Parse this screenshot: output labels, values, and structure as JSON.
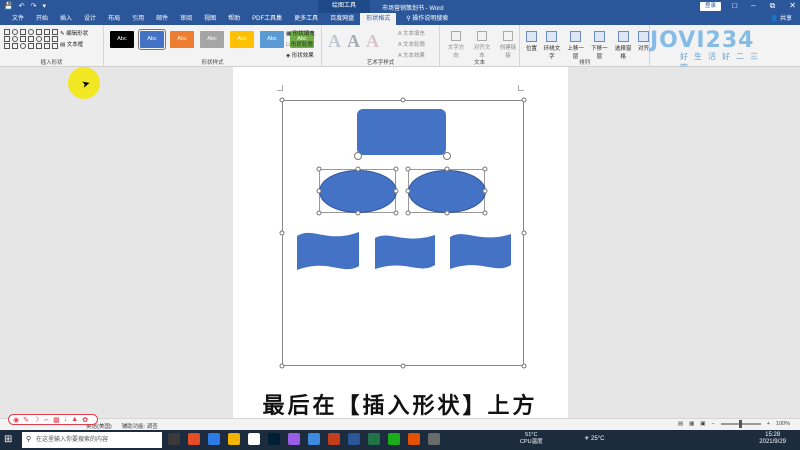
{
  "titlebar": {
    "context_tab": "绘图工具",
    "document_title": "市场营销策划书 - Word",
    "login_label": "登录",
    "window_controls": [
      "minimize-icon",
      "restore-icon",
      "close-icon"
    ]
  },
  "tabs": [
    {
      "label": "文件",
      "active": false
    },
    {
      "label": "开始",
      "active": false
    },
    {
      "label": "插入",
      "active": false
    },
    {
      "label": "设计",
      "active": false
    },
    {
      "label": "布局",
      "active": false
    },
    {
      "label": "引用",
      "active": false
    },
    {
      "label": "邮件",
      "active": false
    },
    {
      "label": "审阅",
      "active": false
    },
    {
      "label": "视图",
      "active": false
    },
    {
      "label": "帮助",
      "active": false
    },
    {
      "label": "PDF工具集",
      "active": false
    },
    {
      "label": "更多工具",
      "active": false
    },
    {
      "label": "百度网盘",
      "active": false
    },
    {
      "label": "形状格式",
      "active": true
    }
  ],
  "tell_me": "操作说明搜索",
  "share_label": "共享",
  "ribbon": {
    "insert_shapes": {
      "edit_shape": "编辑形状",
      "text_box": "文本框",
      "group_label": "插入形状"
    },
    "shape_styles": {
      "swatches": [
        {
          "label": "Abc",
          "color": "#000000"
        },
        {
          "label": "Abc",
          "color": "#4472c4",
          "selected": true
        },
        {
          "label": "Abc",
          "color": "#ed7d31"
        },
        {
          "label": "Abc",
          "color": "#a5a5a5"
        },
        {
          "label": "Abc",
          "color": "#ffc000"
        },
        {
          "label": "Abc",
          "color": "#5b9bd5"
        },
        {
          "label": "Abc",
          "color": "#70ad47"
        }
      ],
      "fill": "形状填充",
      "outline": "形状轮廓",
      "effects": "形状效果",
      "group_label": "形状样式"
    },
    "wordart": {
      "letters": [
        "A",
        "A",
        "A"
      ],
      "text_fill": "文本填充",
      "text_outline": "文本轮廓",
      "text_effects": "文本效果",
      "group_label": "艺术字样式"
    },
    "text": {
      "direction": "文字方向",
      "align": "对齐文本",
      "link": "创建链接",
      "group_label": "文本"
    },
    "arrange": {
      "position": "位置",
      "wrap": "环绕文字",
      "forward": "上移一层",
      "backward": "下移一层",
      "selection_pane": "选择窗格",
      "align": "对齐",
      "group_label": "排列"
    }
  },
  "watermark": {
    "brand": "JOVI234",
    "slogan": "好生活好二三四"
  },
  "caption": "最后在【插入形状】上方",
  "statusbar": {
    "page": "",
    "words": "",
    "language": "英语(美国)",
    "accessibility": "辅助功能: 调查",
    "zoom": "100%"
  },
  "taskbar": {
    "search_placeholder": "在这里输入你要搜索的内容",
    "cpu_temp": "51°C",
    "cpu_label": "CPU温度",
    "weather": "25°C",
    "time": "15:28",
    "date": "2021/9/29"
  },
  "accent_colors": {
    "word_blue": "#2b579a",
    "shape_fill": "#4472c4",
    "cursor_highlight": "#f2e600"
  }
}
